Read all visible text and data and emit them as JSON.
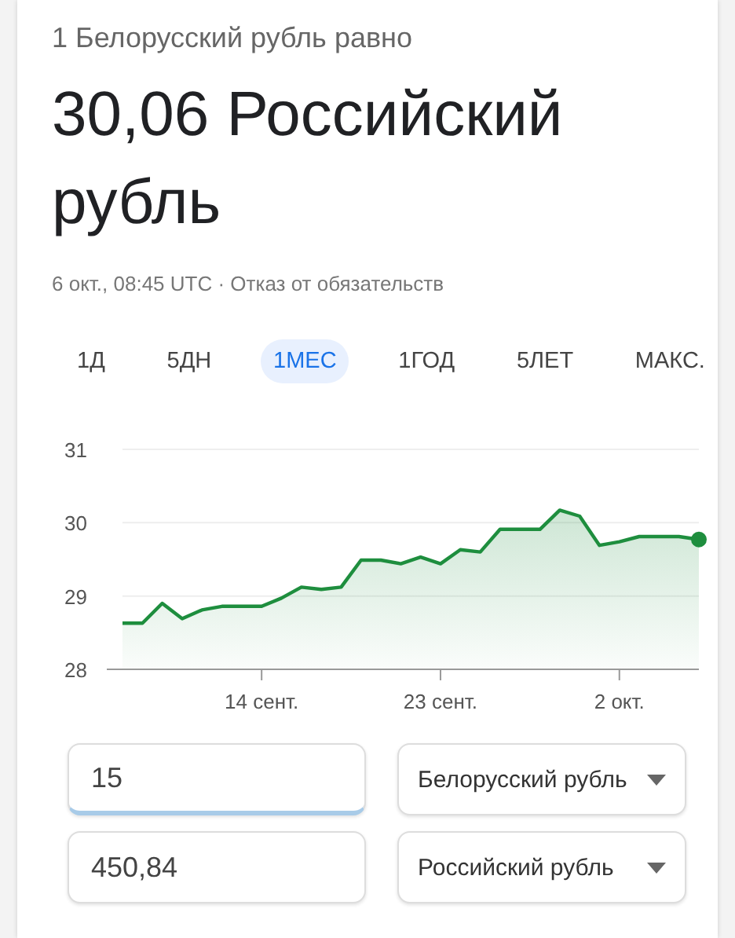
{
  "header": {
    "subtitle": "1 Белорусский рубль равно",
    "result": "30,06 Российский рубль",
    "meta": "6 окт., 08:45 UTC · Отказ от обязательств"
  },
  "tabs": [
    {
      "label": "1Д",
      "selected": false
    },
    {
      "label": "5ДН",
      "selected": false
    },
    {
      "label": "1МЕС",
      "selected": true
    },
    {
      "label": "1ГОД",
      "selected": false
    },
    {
      "label": "5ЛЕТ",
      "selected": false
    },
    {
      "label": "МАКС.",
      "selected": false
    }
  ],
  "chart": {
    "chart_data": {
      "type": "area",
      "categories": [
        null,
        null,
        null,
        null,
        null,
        null,
        null,
        "14 сент.",
        null,
        null,
        null,
        null,
        null,
        null,
        null,
        null,
        "23 сент.",
        null,
        null,
        null,
        null,
        null,
        null,
        null,
        null,
        "2 окт.",
        null,
        null,
        null,
        null
      ],
      "series": [
        {
          "color": "#1e8e3e",
          "values": [
            28.63,
            28.63,
            28.9,
            28.69,
            28.81,
            28.86,
            28.86,
            28.86,
            28.97,
            29.12,
            29.09,
            29.12,
            29.49,
            29.49,
            29.44,
            29.53,
            29.44,
            29.63,
            29.6,
            29.91,
            29.91,
            29.91,
            30.17,
            30.09,
            29.69,
            29.74,
            29.81,
            29.81,
            29.81,
            29.77
          ]
        }
      ],
      "ylim": [
        28,
        31
      ],
      "yticks": [
        28,
        29,
        30,
        31
      ]
    }
  },
  "converter": [
    {
      "value": "15",
      "currency": "Белорусский рубль",
      "focused": true
    },
    {
      "value": "450,84",
      "currency": "Российский рубль",
      "focused": false
    }
  ]
}
